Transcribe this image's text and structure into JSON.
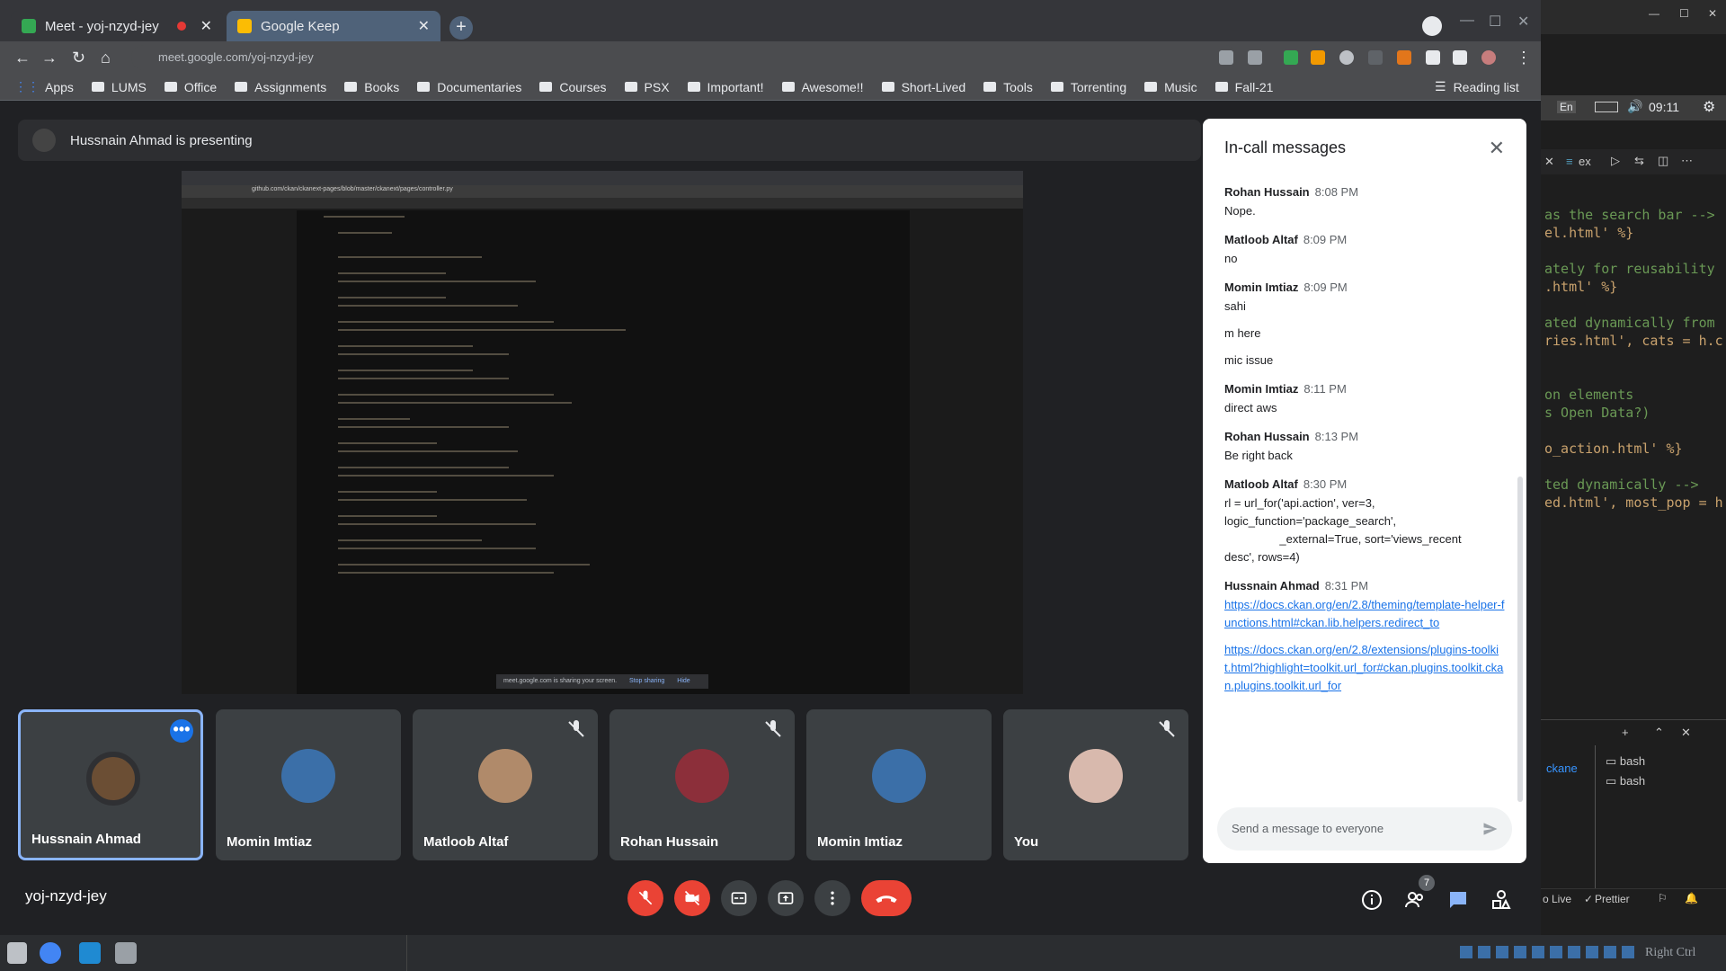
{
  "browser": {
    "tabs": [
      {
        "label": "Meet - yoj-nzyd-jey",
        "active": false
      },
      {
        "label": "Google Keep",
        "active": true
      }
    ],
    "url": "meet.google.com/yoj-nzyd-jey",
    "bookmarks": [
      "Apps",
      "LUMS",
      "Office",
      "Assignments",
      "Books",
      "Documentaries",
      "Courses",
      "PSX",
      "Important!",
      "Awesome!!",
      "Short-Lived",
      "Tools",
      "Torrenting",
      "Music",
      "Fall-21"
    ],
    "reading_list": "Reading list"
  },
  "meet": {
    "presenting": "Hussnain Ahmad is presenting",
    "meeting_code": "yoj-nzyd-jey",
    "participant_count": "7",
    "participants": [
      {
        "name": "Hussnain Ahmad",
        "muted": false,
        "active": true
      },
      {
        "name": "Momin Imtiaz",
        "muted": false,
        "active": false
      },
      {
        "name": "Matloob Altaf",
        "muted": true,
        "active": false
      },
      {
        "name": "Rohan Hussain",
        "muted": true,
        "active": false
      },
      {
        "name": "Momin Imtiaz",
        "muted": false,
        "active": false
      },
      {
        "name": "You",
        "muted": true,
        "active": false
      }
    ],
    "shared_screen": {
      "url": "github.com/ckan/ckanext-pages/blob/master/ckanext/pages/controller.py",
      "share_notice": "meet.google.com is sharing your screen.",
      "stop_sharing": "Stop sharing",
      "hide": "Hide"
    }
  },
  "chat": {
    "title": "In-call messages",
    "placeholder": "Send a message to everyone",
    "messages": [
      {
        "sender": "Rohan Hussain",
        "time": "8:08 PM",
        "lines": [
          "Nope."
        ]
      },
      {
        "sender": "Matloob Altaf",
        "time": "8:09 PM",
        "lines": [
          "no"
        ]
      },
      {
        "sender": "Momin Imtiaz",
        "time": "8:09 PM",
        "lines": [
          "sahi",
          "m here",
          "mic issue"
        ]
      },
      {
        "sender": "Momin Imtiaz",
        "time": "8:11 PM",
        "lines": [
          "direct aws"
        ]
      },
      {
        "sender": "Rohan Hussain",
        "time": "8:13 PM",
        "lines": [
          "Be right back"
        ]
      },
      {
        "sender": "Matloob Altaf",
        "time": "8:30 PM",
        "lines": [
          "rl = url_for('api.action', ver=3,\nlogic_function='package_search',\n                 _external=True, sort='views_recent\ndesc', rows=4)"
        ]
      },
      {
        "sender": "Hussnain Ahmad",
        "time": "8:31 PM",
        "links": [
          "https://docs.ckan.org/en/2.8/theming/template-helper-functions.html#ckan.lib.helpers.redirect_to",
          "https://docs.ckan.org/en/2.8/extensions/plugins-toolkit.html?highlight=toolkit.url_for#ckan.plugins.toolkit.ckan.plugins.toolkit.url_for"
        ]
      }
    ]
  },
  "system": {
    "clock": "09:11",
    "lang": "En"
  },
  "vscode": {
    "tab": "ex",
    "code_lines": [
      "as the search bar -->",
      "el.html' %}",
      "ately for reusability",
      ".html' %}",
      "ated dynamically from",
      "ries.html', cats = h.c",
      "on elements",
      "s Open Data?)",
      "o_action.html' %}",
      "ted dynamically -->",
      "ed.html', most_pop = h"
    ],
    "terminal": [
      "bash",
      "bash"
    ],
    "search_word": "ckane",
    "status": [
      "o Live",
      "Prettier"
    ]
  },
  "taskbar": {
    "right_label": "Right Ctrl"
  }
}
